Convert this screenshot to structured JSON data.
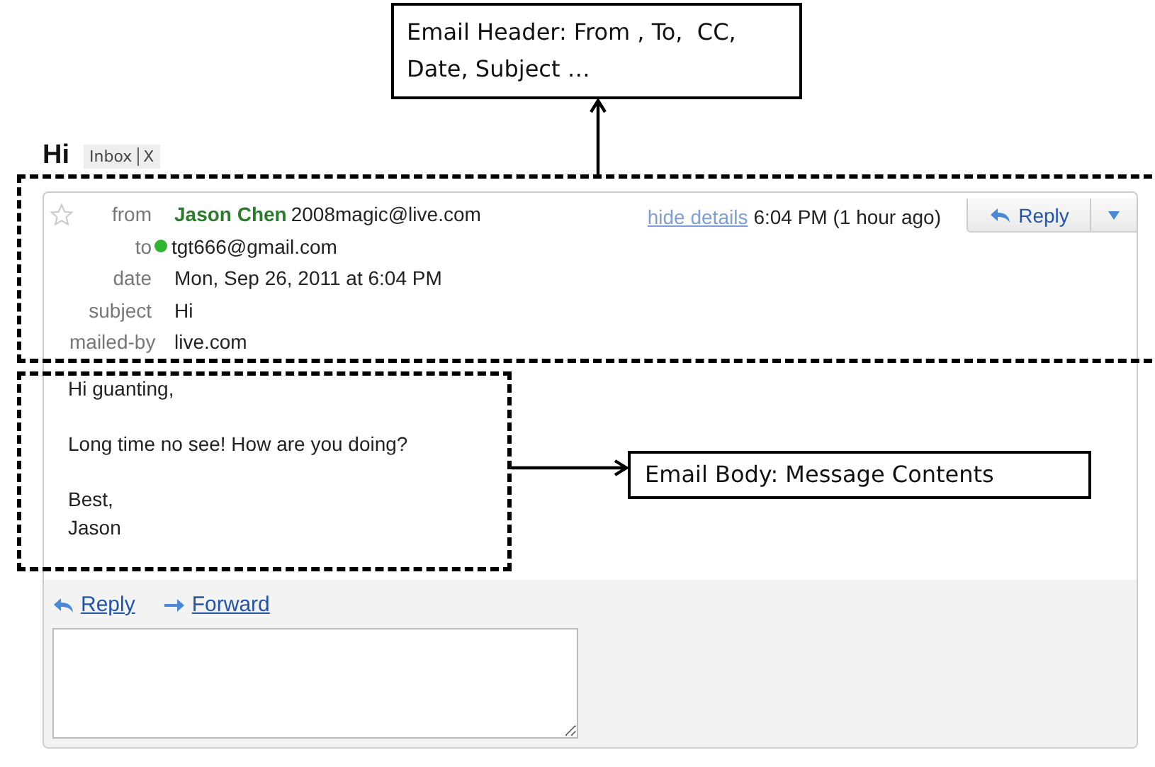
{
  "conversation": {
    "subject": "Hi",
    "labels": [
      {
        "name": "Inbox",
        "remove": "X"
      }
    ]
  },
  "message": {
    "starred": false,
    "fields": [
      {
        "kind": "sender",
        "label": "from",
        "name": "Jason Chen",
        "address": "2008magic@live.com"
      },
      {
        "kind": "presence",
        "label": "to",
        "online": true,
        "value": "tgt666@gmail.com"
      },
      {
        "kind": "plain",
        "label": "date",
        "value": "Mon, Sep 26, 2011 at 6:04 PM"
      },
      {
        "kind": "plain",
        "label": "subject",
        "value": "Hi"
      },
      {
        "kind": "plain",
        "label": "mailed-by",
        "value": "live.com"
      }
    ],
    "details_link": "hide details",
    "time": "6:04 PM (1 hour ago)",
    "reply_button": "Reply",
    "body": [
      [
        "Hi guanting,"
      ],
      [
        "Long time no see! How are you doing?"
      ],
      [
        "Best,",
        "Jason"
      ]
    ],
    "footer_links": [
      {
        "kind": "reply",
        "label": "Reply"
      },
      {
        "kind": "forward",
        "label": "Forward"
      }
    ]
  },
  "annotations": [
    {
      "kind": "header",
      "text": "Email Header: From , To,  CC, Date, Subject …"
    },
    {
      "kind": "body",
      "text": "Email Body: Message Contents"
    }
  ]
}
